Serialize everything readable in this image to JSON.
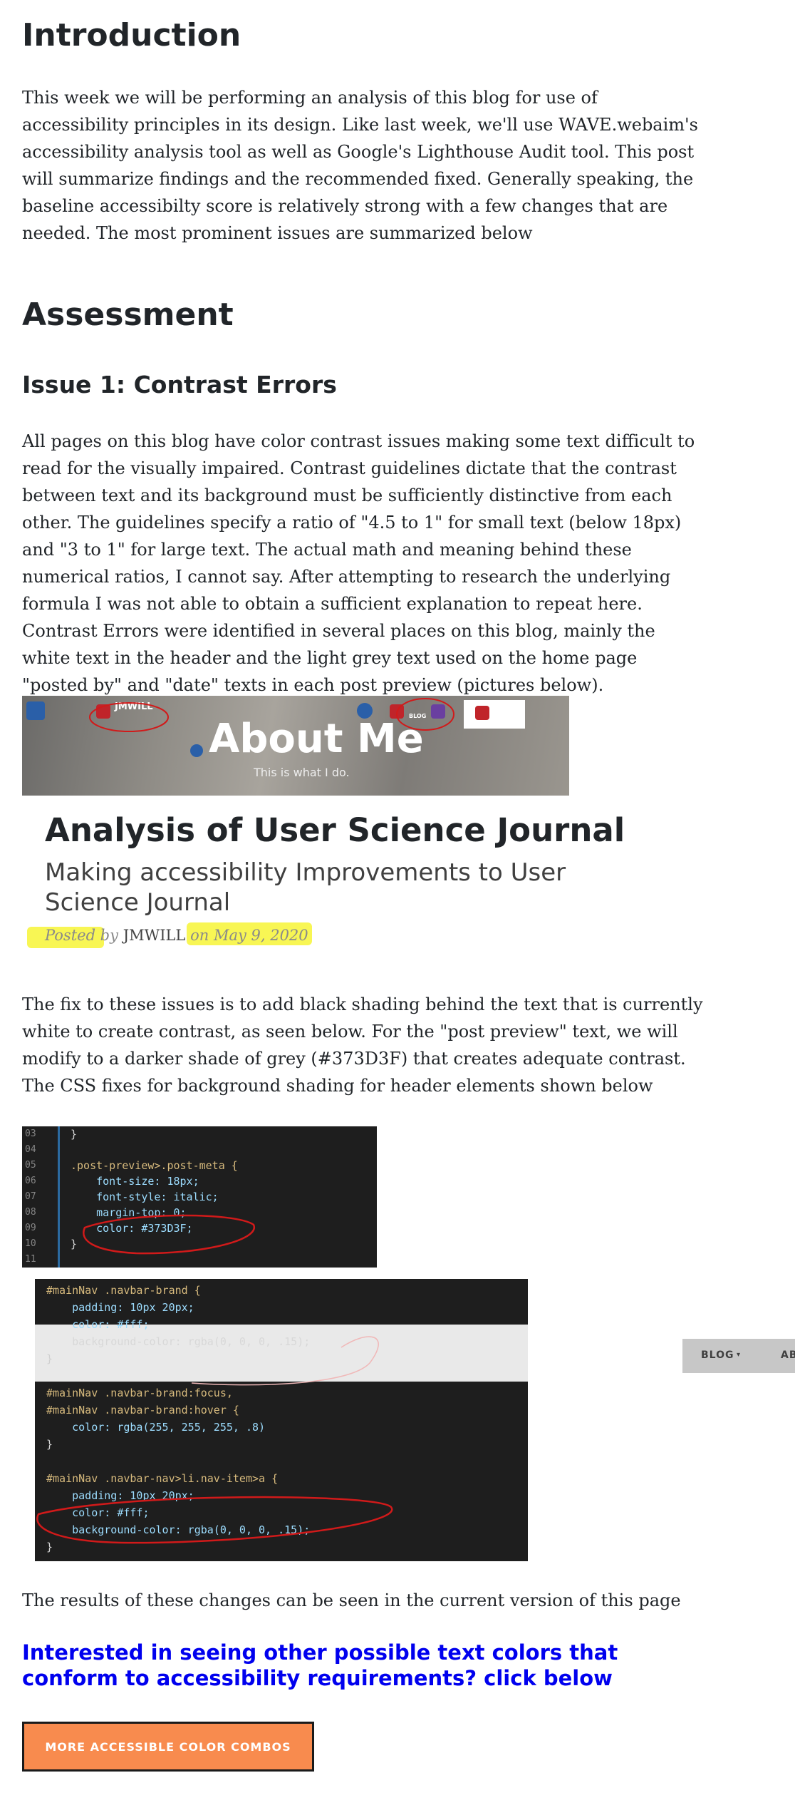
{
  "sections": {
    "intro_heading": "Introduction",
    "intro_text": "This week we will be performing an analysis of this blog for use of accessibility principles in its design. Like last week, we'll use WAVE.webaim's accessibility analysis tool as well as Google's Lighthouse Audit tool. This post will summarize findings and the recommended fixed. Generally speaking, the baseline accessibilty score is relatively strong with a few changes that are needed. The most prominent issues are summarized below",
    "assessment_heading": "Assessment",
    "issue1_heading": "Issue 1: Contrast Errors",
    "issue1_text": "All pages on this blog have color contrast issues making some text difficult to read for the visually impaired. Contrast guidelines dictate that the contrast between text and its background must be sufficiently distinctive from each other. The guidelines specify a ratio of \"4.5 to 1\" for small text (below 18px) and \"3 to 1\" for large text. The actual math and meaning behind these numerical ratios, I cannot say. After attempting to research the underlying formula I was not able to obtain a sufficient explanation to repeat here. Contrast Errors were identified in several places on this blog, mainly the white text in the header and the light grey text used on the home page \"posted by\" and \"date\" texts in each post preview (pictures below).",
    "fix_text": "The fix to these issues is to add black shading behind the text that is currently white to create contrast, as seen below. For the \"post preview\" text, we will modify to a darker shade of grey (#373D3F) that creates adequate contrast. The CSS fixes for background shading for header elements shown below",
    "results_text": "The results of these changes can be seen in the current version of this page",
    "interest_heading": "Interested in seeing other possible text colors that conform to accessibility requirements? click below",
    "button_label": "MORE ACCESSIBLE COLOR COMBOS"
  },
  "header_screenshot": {
    "brand": "JMWILL",
    "title": "About Me",
    "tagline": "This is what I do.",
    "blog_badge": "BLOG"
  },
  "preview_screenshot": {
    "title": "Analysis of User Science Journal",
    "subtitle": "Making accessibility Improvements to User Science Journal",
    "posted_by": "Posted by",
    "author": "JMWILL",
    "on": "on",
    "date": "May 9, 2020"
  },
  "code_screenshot_1": {
    "line_numbers": [
      "03",
      "04",
      "05",
      "06",
      "07",
      "08",
      "09",
      "10",
      "11"
    ],
    "lines": [
      "}",
      "",
      ".post-preview>.post-meta {",
      "    font-size: 18px;",
      "    font-style: italic;",
      "    margin-top: 0;",
      "    color: #373D3F;",
      "}",
      ""
    ]
  },
  "code_screenshot_2": {
    "lines": [
      "#mainNav .navbar-brand {",
      "    padding: 10px 20px;",
      "    color: #fff;",
      "    background-color: rgba(0, 0, 0, .15);",
      "}",
      "",
      "#mainNav .navbar-brand:focus,",
      "#mainNav .navbar-brand:hover {",
      "    color: rgba(255, 255, 255, .8)",
      "}",
      "",
      "#mainNav .navbar-nav>li.nav-item>a {",
      "    padding: 10px 20px;",
      "    color: #fff;",
      "    background-color: rgba(0, 0, 0, .15);",
      "}"
    ]
  },
  "nav_fragment": {
    "blog": "BLOG",
    "blog_caret": "▾",
    "next": "AB"
  },
  "colors": {
    "link_blue": "#0000ee",
    "button_orange": "#f88b4e",
    "highlight_yellow": "#f7f436",
    "annotation_red": "#d11a1a"
  }
}
